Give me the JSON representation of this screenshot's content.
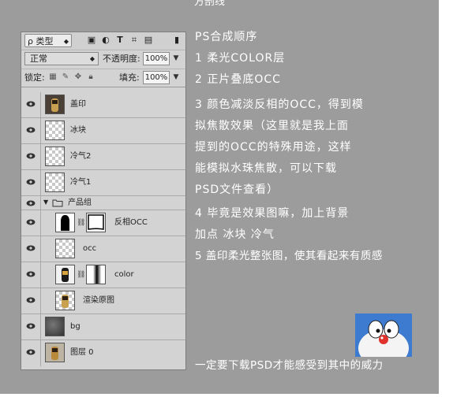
{
  "top_caption": "方剖线",
  "panel": {
    "kind_label": "ρ 类型",
    "toolbar_icons": [
      "image-filter-icon",
      "adjustment-filter-icon",
      "type-filter-icon",
      "shape-filter-icon",
      "smart-object-filter-icon"
    ],
    "blend_mode": "正常",
    "opacity_label": "不透明度:",
    "opacity_value": "100%",
    "lock_label": "锁定:",
    "fill_label": "填充:",
    "fill_value": "100%",
    "layers": [
      {
        "name": "盖印"
      },
      {
        "name": "冰块"
      },
      {
        "name": "冷气2"
      },
      {
        "name": "冷气1"
      },
      {
        "name": "产品组",
        "group": true
      },
      {
        "name": "反相OCC"
      },
      {
        "name": "occ"
      },
      {
        "name": "color"
      },
      {
        "name": "渲染原图"
      },
      {
        "name": "bg"
      },
      {
        "name": "图层 0"
      }
    ]
  },
  "notes": {
    "title": "PS合成顺序",
    "line1": "1 柔光COLOR层",
    "line2": "2 正片叠底OCC",
    "line3a": "3 颜色减淡反相的OCC，得到模",
    "line3b": "拟焦散效果（这里就是我上面",
    "line3c": "提到的OCC的特殊用途，这样",
    "line3d": "能模拟水珠焦散，可以下载",
    "line3e": "PSD文件查看）",
    "line4a": "4 毕竟是效果图嘛，加上背景",
    "line4b": "加点 冰块 冷气",
    "line5": "5 盖印柔光整张图，使其看起来有质感",
    "footer": "一定要下载PSD才能感受到其中的威力"
  }
}
